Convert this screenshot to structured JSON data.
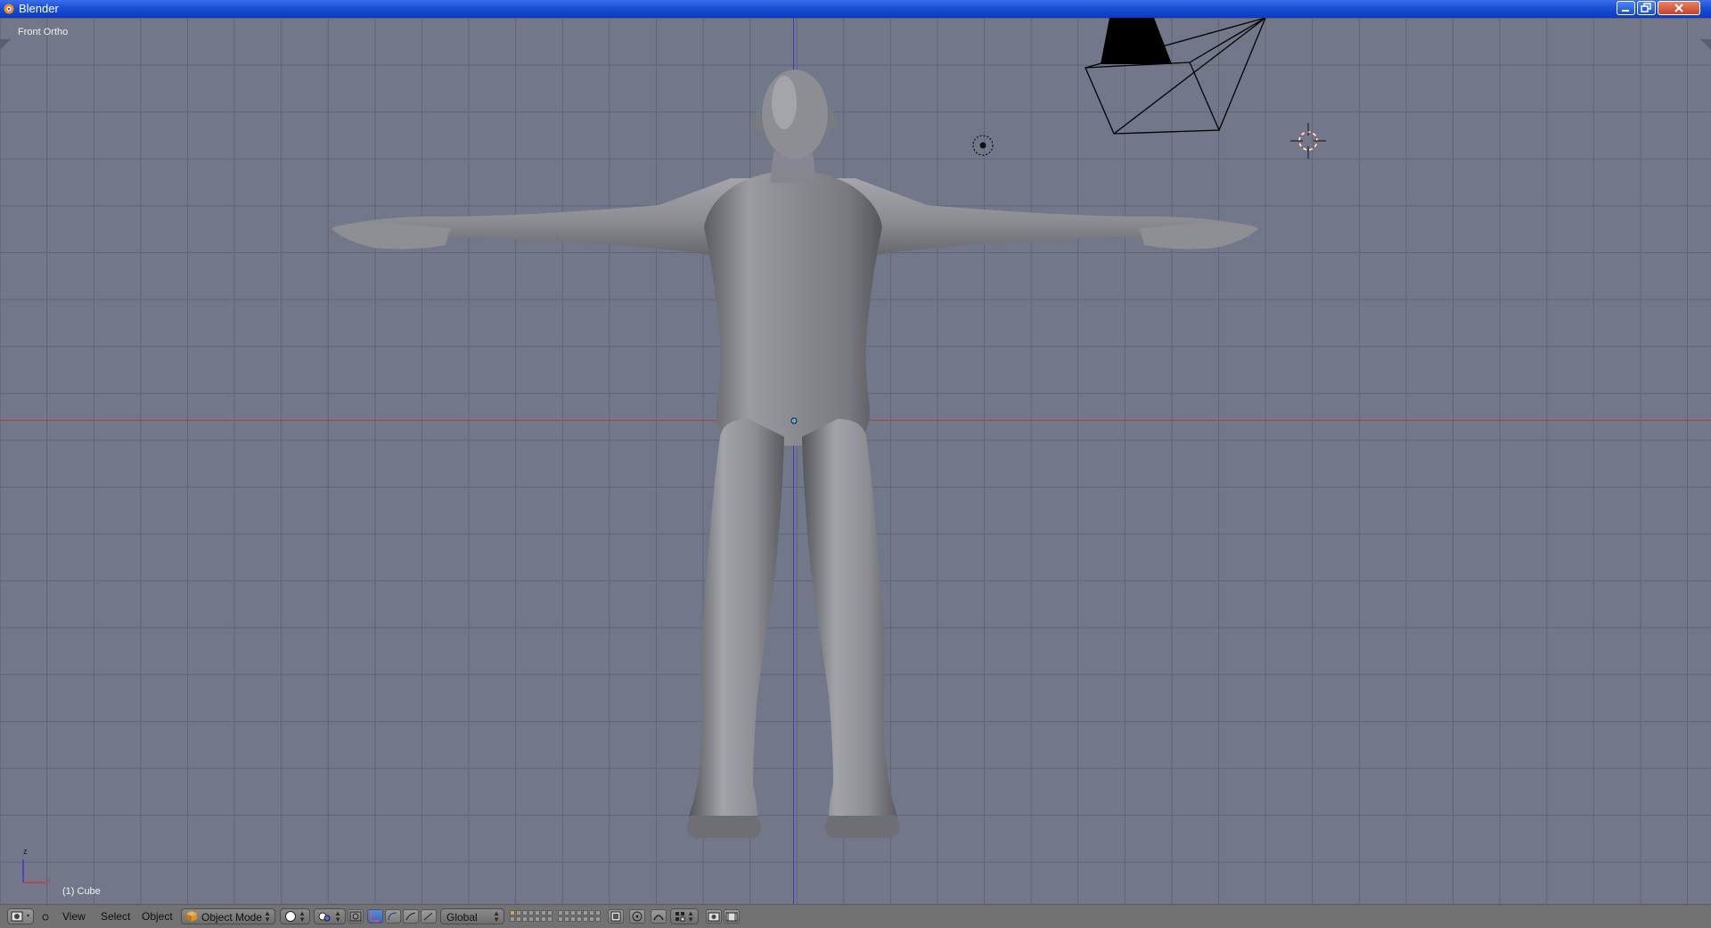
{
  "window": {
    "title": "Blender"
  },
  "viewport": {
    "view_label": "Front Ortho",
    "object_label": "(1) Cube",
    "axis_z": "z",
    "axis_x": "x"
  },
  "header": {
    "menus": {
      "view": "View",
      "select": "Select",
      "object": "Object"
    },
    "mode": "Object Mode",
    "orientation": "Global"
  },
  "colors": {
    "titlebar": "#1a4fd6",
    "viewport_bg": "#727789",
    "grid_line": "#5f6477",
    "x_axis": "#a8404a",
    "z_axis": "#3a3ad0",
    "header_bg": "#727272"
  },
  "icons": [
    "blender-logo-icon",
    "minimize-icon",
    "maximize-icon",
    "close-icon",
    "editor-type-icon",
    "object-mode-cube-icon",
    "viewport-shading-icon",
    "pivot-point-icon",
    "manipulator-icon",
    "layers-icon",
    "render-icon",
    "camera-icon",
    "lamp-icon",
    "3d-cursor-icon"
  ]
}
